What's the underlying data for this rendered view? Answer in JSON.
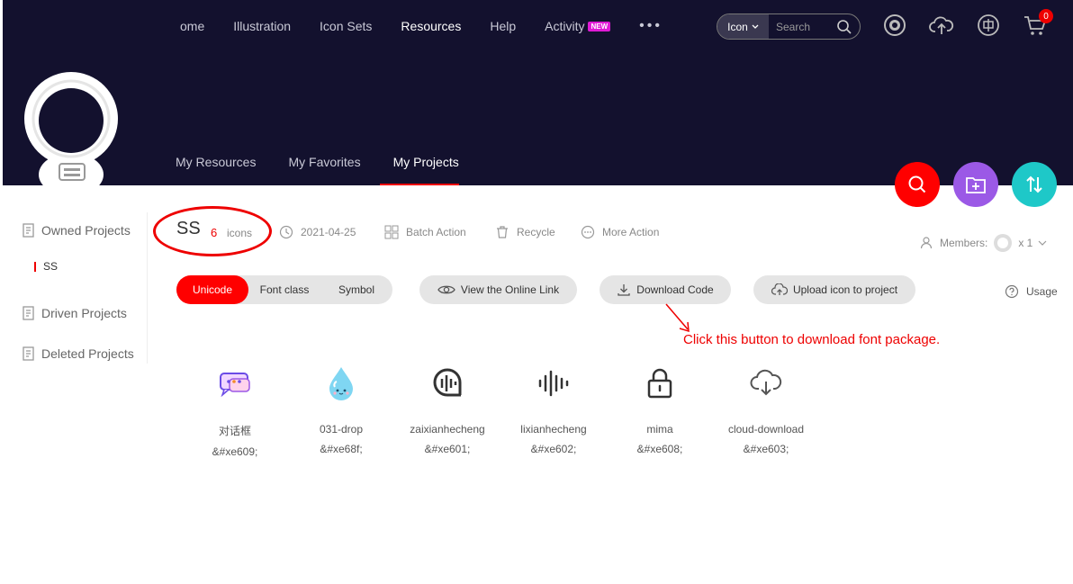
{
  "nav": {
    "items": [
      "ome",
      "Illustration",
      "Icon Sets",
      "Resources",
      "Help",
      "Activity"
    ],
    "active": "Resources",
    "activity_badge": "NEW",
    "more": "•••"
  },
  "search": {
    "type": "Icon",
    "placeholder": "Search"
  },
  "cart": {
    "count": "0"
  },
  "subnav": {
    "tabs": [
      "My Resources",
      "My Favorites",
      "My Projects"
    ],
    "active": "My Projects"
  },
  "sidebar": {
    "owned": "Owned Projects",
    "owned_sub": "SS",
    "driven": "Driven Projects",
    "deleted": "Deleted Projects"
  },
  "project": {
    "title": "SS",
    "count": "6",
    "count_label": "icons",
    "date": "2021-04-25",
    "batch": "Batch Action",
    "recycle": "Recycle",
    "more": "More Action",
    "members_label": "Members:",
    "members_count": "x 1"
  },
  "toolbar": {
    "modes": [
      "Unicode",
      "Font class",
      "Symbol"
    ],
    "selected_mode": "Unicode",
    "online_link": "View the Online Link",
    "download": "Download Code",
    "upload": "Upload icon to project",
    "usage": "Usage"
  },
  "annotation": "Click this button to download font package.",
  "icons": [
    {
      "name": "对话框",
      "code": "&#xe609;",
      "icon": "chat-bubble-icon"
    },
    {
      "name": "031-drop",
      "code": "&#xe68f;",
      "icon": "water-drop-icon"
    },
    {
      "name": "zaixianhecheng",
      "code": "&#xe601;",
      "icon": "audio-wave-circle-icon"
    },
    {
      "name": "lixianhecheng",
      "code": "&#xe602;",
      "icon": "audio-wave-icon"
    },
    {
      "name": "mima",
      "code": "&#xe608;",
      "icon": "lock-icon"
    },
    {
      "name": "cloud-download",
      "code": "&#xe603;",
      "icon": "cloud-download-icon"
    }
  ],
  "colors": {
    "header": "#13112e",
    "accent": "#ff0000",
    "purple": "#9b59e6",
    "teal": "#1ec8c8"
  }
}
